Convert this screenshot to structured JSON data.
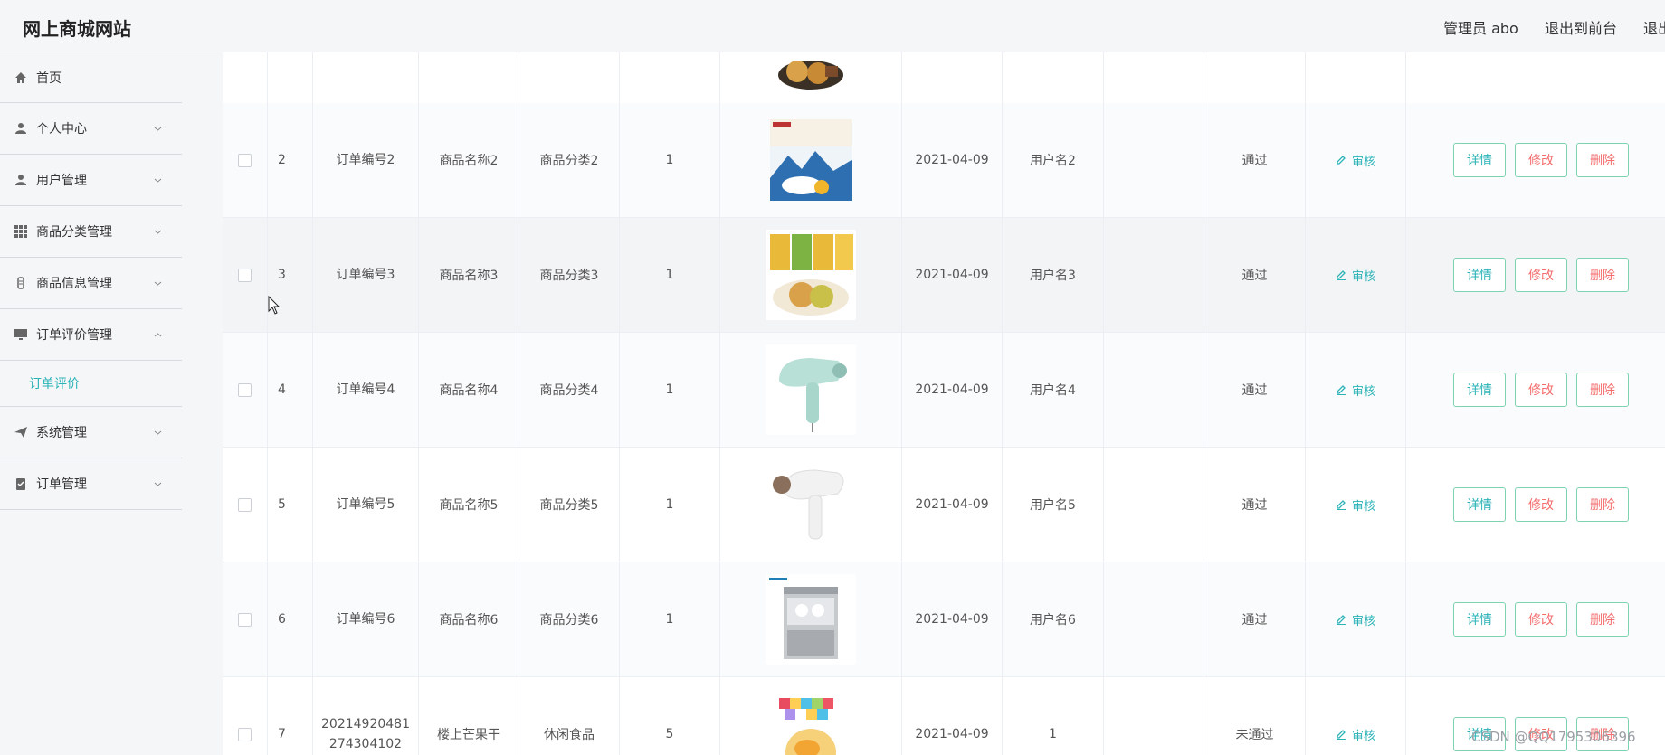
{
  "header": {
    "brand": "网上商城网站",
    "admin": "管理员 abo",
    "to_front": "退出到前台",
    "logout": "退出"
  },
  "sidebar": {
    "home": "首页",
    "items": [
      {
        "label": "个人中心",
        "icon": "user-icon",
        "expanded": false
      },
      {
        "label": "用户管理",
        "icon": "user-icon",
        "expanded": false
      },
      {
        "label": "商品分类管理",
        "icon": "grid-icon",
        "expanded": false
      },
      {
        "label": "商品信息管理",
        "icon": "goods-icon",
        "expanded": false
      },
      {
        "label": "订单评价管理",
        "icon": "monitor-icon",
        "expanded": true,
        "sub": "订单评价"
      },
      {
        "label": "系统管理",
        "icon": "send-icon",
        "expanded": false
      },
      {
        "label": "订单管理",
        "icon": "clipboard-icon",
        "expanded": false
      }
    ]
  },
  "table": {
    "review_label": "审核",
    "btn_detail": "详情",
    "btn_edit": "修改",
    "btn_delete": "删除",
    "rows": [
      {
        "no": "2",
        "order": "订单编号2",
        "name": "商品名称2",
        "category": "商品分类2",
        "qty": "1",
        "image": "snack-box",
        "date": "2021-04-09",
        "user": "用户名2",
        "status": "通过"
      },
      {
        "no": "3",
        "order": "订单编号3",
        "name": "商品名称3",
        "category": "商品分类3",
        "qty": "1",
        "image": "pastry",
        "date": "2021-04-09",
        "user": "用户名3",
        "status": "通过"
      },
      {
        "no": "4",
        "order": "订单编号4",
        "name": "商品名称4",
        "category": "商品分类4",
        "qty": "1",
        "image": "hair-dryer-green",
        "date": "2021-04-09",
        "user": "用户名4",
        "status": "通过"
      },
      {
        "no": "5",
        "order": "订单编号5",
        "name": "商品名称5",
        "category": "商品分类5",
        "qty": "1",
        "image": "hair-dryer-white",
        "date": "2021-04-09",
        "user": "用户名5",
        "status": "通过"
      },
      {
        "no": "6",
        "order": "订单编号6",
        "name": "商品名称6",
        "category": "商品分类6",
        "qty": "1",
        "image": "dishwasher",
        "date": "2021-04-09",
        "user": "用户名6",
        "status": "通过"
      },
      {
        "no": "7",
        "order": "20214920481 274304102",
        "name": "楼上芒果干",
        "category": "休闲食品",
        "qty": "5",
        "image": "mango-bag",
        "date": "2021-04-09",
        "user": "1",
        "status": "未通过"
      }
    ]
  },
  "watermark": "CSDN @QQ1795306396"
}
